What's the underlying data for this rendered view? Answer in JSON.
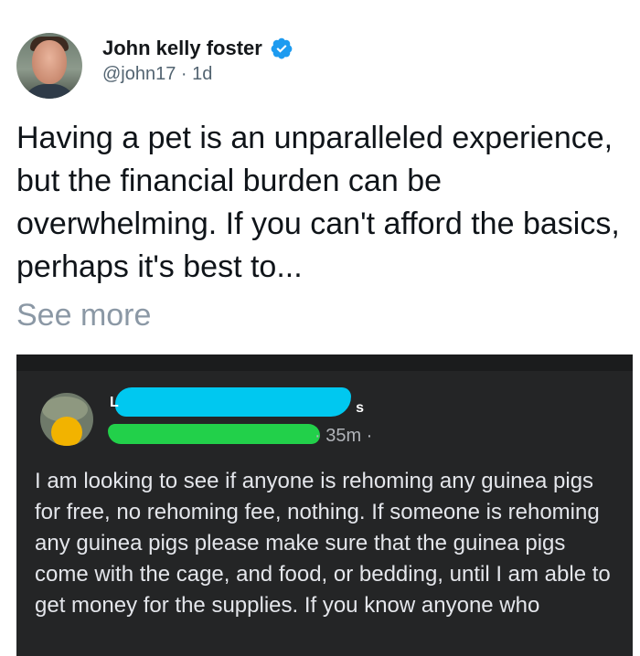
{
  "tweet": {
    "author_name": "John kelly foster",
    "handle": "@john17",
    "time": "1d",
    "handle_time": "@john17 · 1d",
    "text": "Having a pet is an unparalleled experience, but the financial burden can be overwhelming. If you can't afford the basics, perhaps it's best to...",
    "see_more": "See more"
  },
  "embedded_post": {
    "timestamp": "· 35m ·",
    "text": "I am looking to see if anyone is rehoming any guinea pigs for free, no rehoming fee, nothing. If someone is rehoming any guinea pigs please make sure that the guinea pigs come with the cage, and food, or bedding, until I am able to get money for the supplies. If you know anyone who"
  },
  "colors": {
    "verified": "#1d9bf0",
    "handle": "#536471",
    "embed_bg": "#242526",
    "redact_blue": "#00c8f0",
    "redact_green": "#22d04a"
  },
  "icons": {
    "verified": "verified-badge-icon"
  }
}
